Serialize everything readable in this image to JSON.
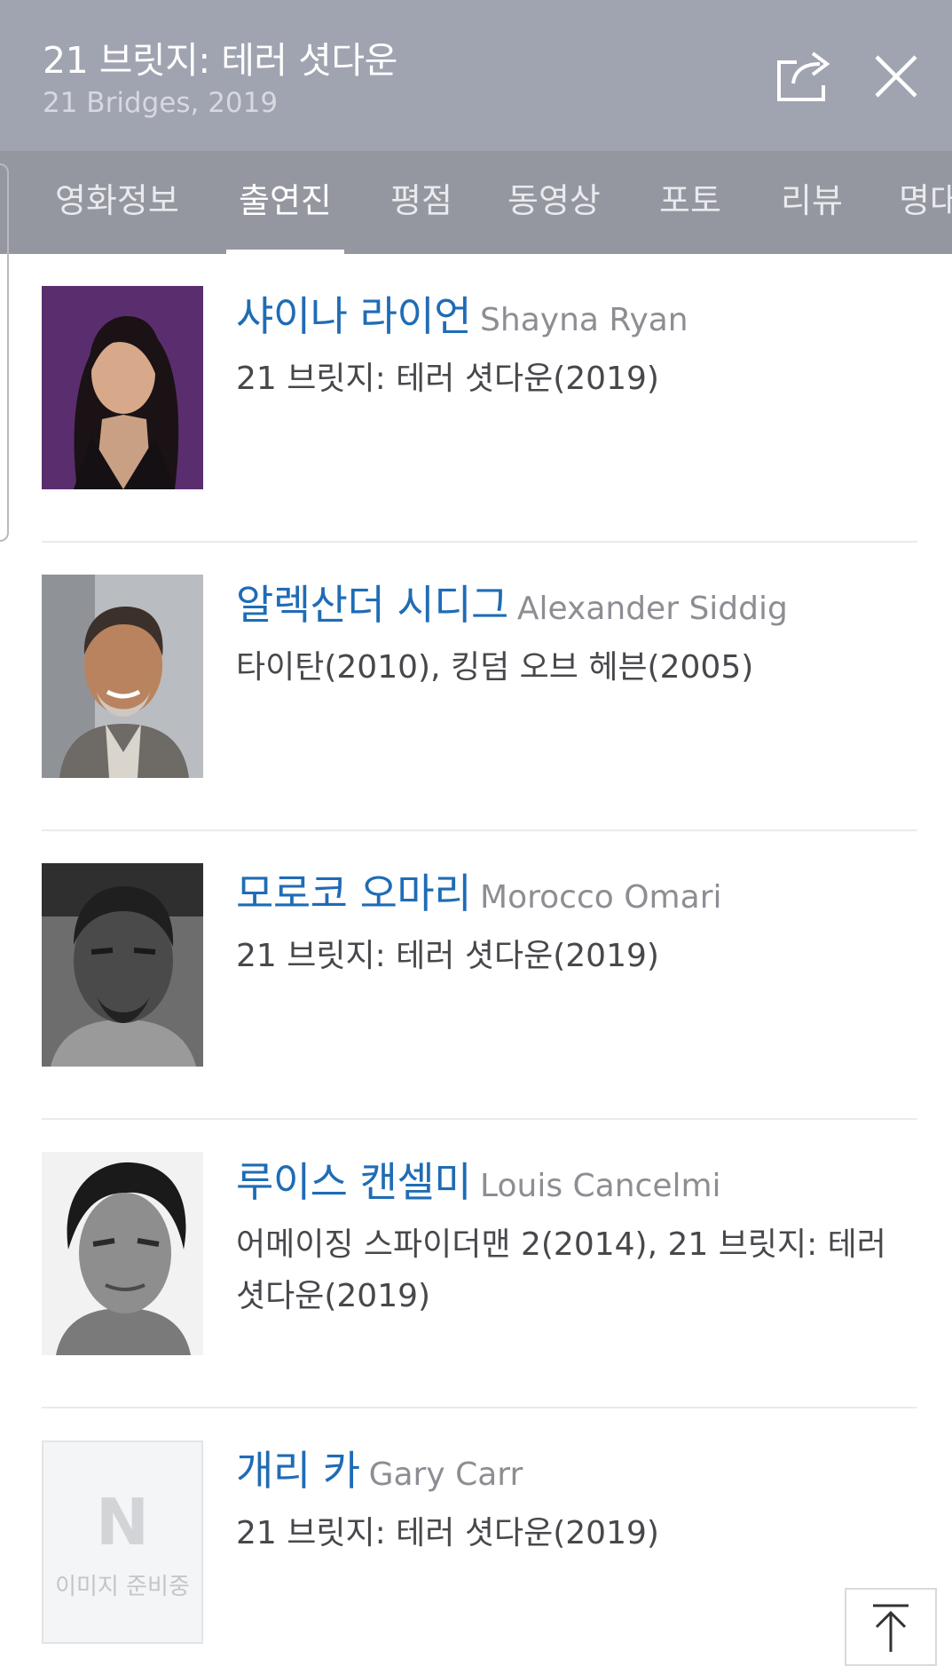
{
  "header": {
    "title": "21 브릿지: 테러 셧다운",
    "subtitle": "21 Bridges, 2019",
    "share_icon": "share-icon",
    "close_icon": "close-icon"
  },
  "tabs": [
    {
      "label": "영화정보",
      "active": false
    },
    {
      "label": "출연진",
      "active": true
    },
    {
      "label": "평점",
      "active": false
    },
    {
      "label": "동영상",
      "active": false
    },
    {
      "label": "포토",
      "active": false
    },
    {
      "label": "리뷰",
      "active": false
    },
    {
      "label": "명대",
      "active": false
    }
  ],
  "cast": [
    {
      "name_ko": "샤이나 라이언",
      "name_en": "Shayna Ryan",
      "films": "21 브릿지: 테러 셧다운(2019)"
    },
    {
      "name_ko": "알렉산더 시디그",
      "name_en": "Alexander Siddig",
      "films": "타이탄(2010), 킹덤 오브 헤븐(2005)"
    },
    {
      "name_ko": "모로코 오마리",
      "name_en": "Morocco Omari",
      "films": "21 브릿지: 테러 셧다운(2019)"
    },
    {
      "name_ko": "루이스 캔셀미",
      "name_en": "Louis Cancelmi",
      "films": "어메이징 스파이더맨 2(2014), 21 브릿지: 테러 셧다운(2019)"
    },
    {
      "name_ko": "개리 카",
      "name_en": "Gary Carr",
      "films": "21 브릿지: 테러 셧다운(2019)"
    }
  ],
  "placeholder": {
    "logo_letter": "N",
    "text": "이미지 준비중"
  },
  "top_button_icon": "scroll-top-icon",
  "colors": {
    "header_bg": "#a0a3b0",
    "tab_bg": "#94979f",
    "name_blue": "#1f6cb5"
  }
}
